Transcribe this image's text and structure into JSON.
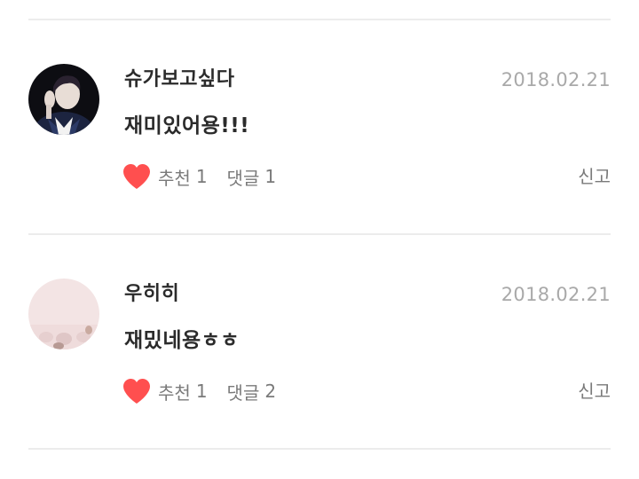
{
  "comments": [
    {
      "username": "슈가보고싶다",
      "date": "2018.02.21",
      "text": "재미있어용!!!",
      "like_label": "추천",
      "like_count": "1",
      "reply_label": "댓글",
      "reply_count": "1",
      "report_label": "신고",
      "avatar": "profile-photo-dark"
    },
    {
      "username": "우히히",
      "date": "2018.02.21",
      "text": "재밌네용ㅎㅎ",
      "like_label": "추천",
      "like_count": "1",
      "reply_label": "댓글",
      "reply_count": "2",
      "report_label": "신고",
      "avatar": "profile-photo-pink"
    }
  ],
  "colors": {
    "heart": "#ff4f4f",
    "divider": "#ececec",
    "date": "#a9a9a9",
    "meta": "#7a7a7a",
    "text": "#2b2b2b"
  }
}
